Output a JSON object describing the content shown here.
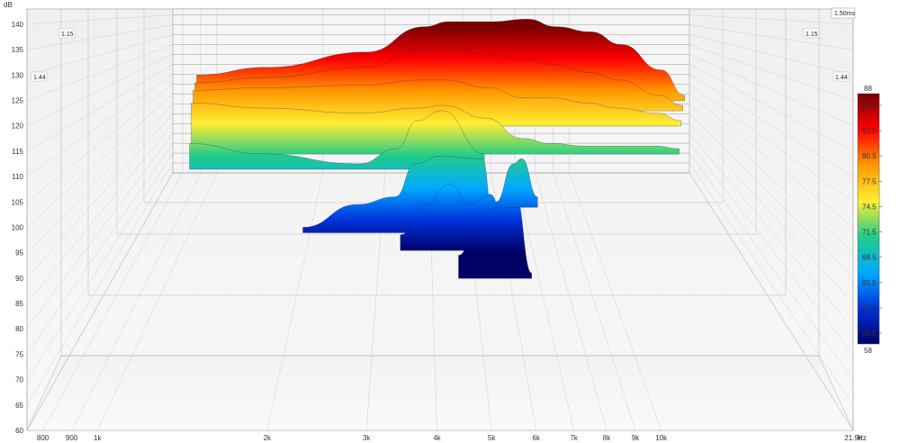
{
  "chart_data": {
    "type": "waterfall-3d",
    "title": "",
    "y_unit": "dB",
    "x_unit": "Hz",
    "time_label": "1.50ms",
    "depth_labels": {
      "back": "1.15",
      "front": "1.44"
    },
    "y_ticks": [
      60,
      65,
      70,
      75,
      80,
      85,
      90,
      95,
      100,
      105,
      110,
      115,
      120,
      125,
      130,
      135,
      140
    ],
    "ylim": [
      60,
      143
    ],
    "x_ticks": [
      "800",
      "900",
      "1k",
      "2k",
      "3k",
      "4k",
      "5k",
      "6k",
      "7k",
      "8k",
      "9k",
      "10k",
      "21.9k"
    ],
    "x_tick_values": [
      800,
      900,
      1000,
      2000,
      3000,
      4000,
      5000,
      6000,
      7000,
      8000,
      9000,
      10000,
      21900
    ],
    "xlim": [
      750,
      21900
    ],
    "x_scale": "log",
    "colorbar": {
      "max": "88",
      "min": "58",
      "ticks": [
        "86.5",
        "83.5",
        "80.5",
        "77.5",
        "74.5",
        "71.5",
        "68.5",
        "65.5",
        "62.5",
        "59.5"
      ],
      "colors": [
        "#7a0000",
        "#ff0000",
        "#ff9900",
        "#ffee33",
        "#22cc88",
        "#00aaff",
        "#0033dd",
        "#000066"
      ]
    },
    "slices": [
      {
        "x": [
          1500,
          2000,
          3000,
          3800,
          4200,
          5000,
          5800,
          6500,
          7500,
          8500,
          10000,
          11000
        ],
        "y": [
          130,
          131.5,
          134.5,
          139.5,
          140.5,
          140.5,
          141,
          139.5,
          138.5,
          136,
          131,
          126
        ]
      },
      {
        "x": [
          1500,
          2000,
          3000,
          3800,
          4200,
          5000,
          5800,
          6500,
          7500,
          8500,
          10000,
          11000
        ],
        "y": [
          128.5,
          129.5,
          131.5,
          135,
          135.5,
          134,
          133,
          132,
          130.5,
          129,
          126,
          124
        ]
      },
      {
        "x": [
          1500,
          2000,
          3000,
          3800,
          4200,
          5000,
          5800,
          6500,
          7500,
          8500,
          10000,
          11000
        ],
        "y": [
          127,
          127.5,
          128,
          129,
          129,
          127.5,
          125.5,
          125.5,
          124.5,
          123.5,
          122.5,
          121
        ]
      },
      {
        "x": [
          1500,
          2000,
          3000,
          3800,
          4200,
          5000,
          5800,
          6500,
          7500,
          8500,
          10000,
          11000
        ],
        "y": [
          124.5,
          123.5,
          122.5,
          123.5,
          124,
          121.5,
          117.5,
          116.5,
          116,
          116,
          116,
          115.5
        ]
      },
      {
        "x": [
          1500,
          2000,
          3000,
          3500,
          3800,
          4200,
          5000
        ],
        "y": [
          116.5,
          114.5,
          112.5,
          115.5,
          121,
          123,
          114.5
        ]
      },
      {
        "x": [
          2400,
          3000,
          3500,
          3800,
          4200,
          5000,
          5200
        ],
        "y": [
          100,
          104.5,
          106,
          112.5,
          114,
          113.5,
          103.5
        ]
      },
      {
        "x": [
          3600,
          4000,
          4400,
          4800,
          5200,
          5600
        ],
        "y": [
          98.5,
          104.5,
          108.5,
          104.5,
          106.5,
          96.5
        ]
      },
      {
        "x": [
          4600,
          5000,
          5400,
          5800,
          6200
        ],
        "y": [
          94.5,
          101.5,
          104,
          106.5,
          91
        ]
      },
      {
        "x": [
          5400,
          5800,
          6000,
          6400
        ],
        "y": [
          105,
          112.5,
          113.5,
          106
        ]
      }
    ]
  }
}
